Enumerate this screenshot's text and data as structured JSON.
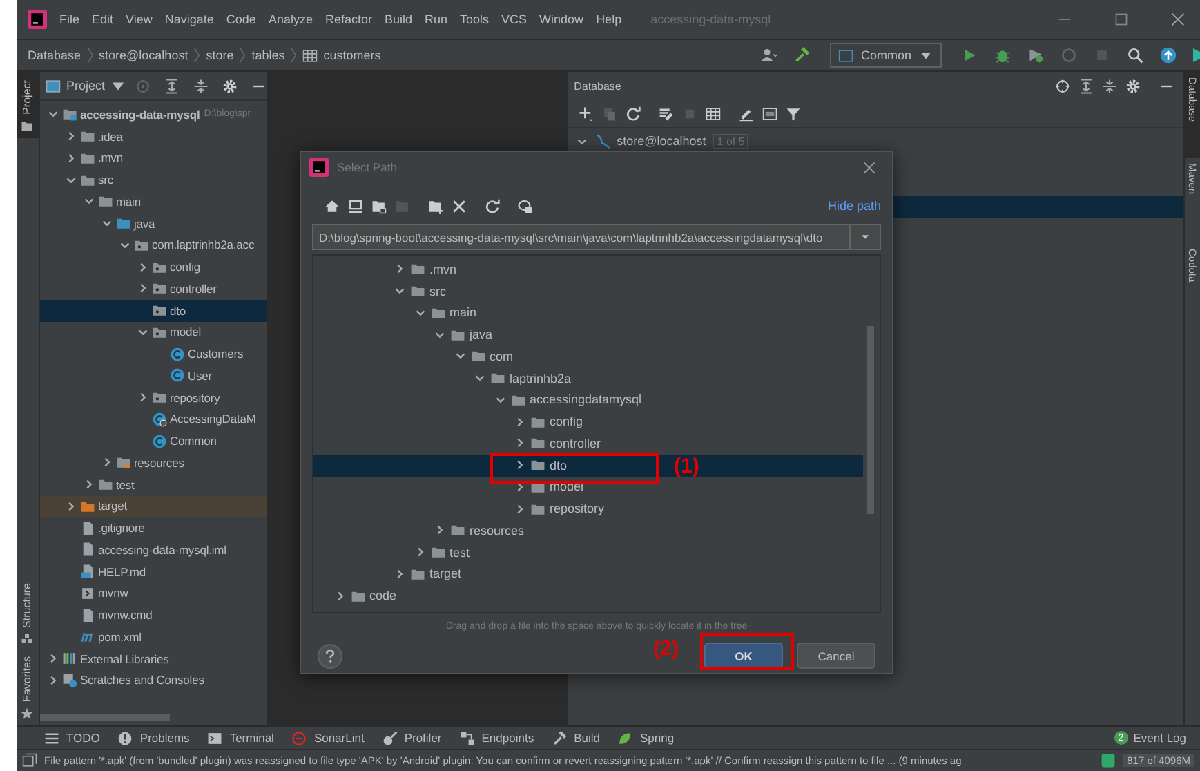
{
  "window": {
    "title": "accessing-data-mysql"
  },
  "menu": [
    "File",
    "Edit",
    "View",
    "Navigate",
    "Code",
    "Analyze",
    "Refactor",
    "Build",
    "Run",
    "Tools",
    "VCS",
    "Window",
    "Help"
  ],
  "breadcrumbs": [
    {
      "label": "Database",
      "kind": "text"
    },
    {
      "label": "store@localhost",
      "kind": "text"
    },
    {
      "label": "store",
      "kind": "text"
    },
    {
      "label": "tables",
      "kind": "text"
    },
    {
      "label": "customers",
      "kind": "table"
    }
  ],
  "run_config": {
    "label": "Common"
  },
  "left_stripe": [
    {
      "label": "Project",
      "selected": true
    },
    {
      "label": "Structure",
      "selected": false
    },
    {
      "label": "Favorites",
      "selected": false
    }
  ],
  "right_stripe": [
    {
      "label": "Database",
      "selected": true
    },
    {
      "label": "Maven",
      "selected": false
    },
    {
      "label": "Codota",
      "selected": false
    }
  ],
  "project": {
    "title": "Project",
    "tree": [
      {
        "label": "accessing-data-mysql",
        "hint": "D:\\blog\\spr",
        "kind": "module",
        "expanded": true,
        "selected": false,
        "children": [
          {
            "label": ".idea",
            "kind": "folder",
            "expanded": false,
            "selected": false
          },
          {
            "label": ".mvn",
            "kind": "folder",
            "expanded": false,
            "selected": false
          },
          {
            "label": "src",
            "kind": "folder",
            "expanded": true,
            "selected": false,
            "children": [
              {
                "label": "main",
                "kind": "folder",
                "expanded": true,
                "selected": false,
                "children": [
                  {
                    "label": "java",
                    "kind": "source",
                    "expanded": true,
                    "selected": false,
                    "children": [
                      {
                        "label": "com.laptrinhb2a.acc",
                        "kind": "package",
                        "expanded": true,
                        "selected": false,
                        "children": [
                          {
                            "label": "config",
                            "kind": "package",
                            "expanded": false,
                            "selected": false
                          },
                          {
                            "label": "controller",
                            "kind": "package",
                            "expanded": false,
                            "selected": false
                          },
                          {
                            "label": "dto",
                            "kind": "package",
                            "selected": true
                          },
                          {
                            "label": "model",
                            "kind": "package",
                            "expanded": true,
                            "selected": false,
                            "children": [
                              {
                                "label": "Customers",
                                "kind": "class",
                                "selected": false
                              },
                              {
                                "label": "User",
                                "kind": "class",
                                "selected": false
                              }
                            ]
                          },
                          {
                            "label": "repository",
                            "kind": "package",
                            "expanded": false,
                            "selected": false
                          },
                          {
                            "label": "AccessingDataM",
                            "kind": "appclass",
                            "selected": false
                          },
                          {
                            "label": "Common",
                            "kind": "class",
                            "selected": false
                          }
                        ]
                      }
                    ]
                  },
                  {
                    "label": "resources",
                    "kind": "resources",
                    "expanded": false,
                    "selected": false
                  }
                ]
              },
              {
                "label": "test",
                "kind": "folder",
                "expanded": false,
                "selected": false
              }
            ]
          },
          {
            "label": "target",
            "kind": "excluded",
            "expanded": false,
            "selected": false
          },
          {
            "label": ".gitignore",
            "kind": "file",
            "selected": false
          },
          {
            "label": "accessing-data-mysql.iml",
            "kind": "file",
            "selected": false
          },
          {
            "label": "HELP.md",
            "kind": "markdown",
            "selected": false
          },
          {
            "label": "mvnw",
            "kind": "script",
            "selected": false
          },
          {
            "label": "mvnw.cmd",
            "kind": "file",
            "selected": false
          },
          {
            "label": "pom.xml",
            "kind": "maven",
            "selected": false
          }
        ]
      },
      {
        "label": "External Libraries",
        "kind": "libraries",
        "expanded": false,
        "selected": false
      },
      {
        "label": "Scratches and Consoles",
        "kind": "scratches",
        "expanded": false,
        "selected": false
      }
    ]
  },
  "database": {
    "title": "Database",
    "tree": [
      {
        "label": "store@localhost",
        "badge": "1 of 5",
        "expanded": true
      }
    ]
  },
  "dialog": {
    "title": "Select Path",
    "hide_path": "Hide path",
    "path": "D:\\blog\\spring-boot\\accessing-data-mysql\\src\\main\\java\\com\\laptrinhb2a\\accessingdatamysql\\dto",
    "tree": [
      {
        "label": ".mvn",
        "expanded": false,
        "selected": false
      },
      {
        "label": "src",
        "expanded": true,
        "selected": false,
        "children": [
          {
            "label": "main",
            "expanded": true,
            "selected": false,
            "children": [
              {
                "label": "java",
                "expanded": true,
                "selected": false,
                "children": [
                  {
                    "label": "com",
                    "expanded": true,
                    "selected": false,
                    "children": [
                      {
                        "label": "laptrinhb2a",
                        "expanded": true,
                        "selected": false,
                        "children": [
                          {
                            "label": "accessingdatamysql",
                            "expanded": true,
                            "selected": false,
                            "children": [
                              {
                                "label": "config",
                                "expanded": false,
                                "selected": false
                              },
                              {
                                "label": "controller",
                                "expanded": false,
                                "selected": false
                              },
                              {
                                "label": "dto",
                                "expanded": false,
                                "selected": true
                              },
                              {
                                "label": "model",
                                "expanded": false,
                                "selected": false
                              },
                              {
                                "label": "repository",
                                "expanded": false,
                                "selected": false
                              }
                            ]
                          }
                        ]
                      }
                    ]
                  }
                ]
              },
              {
                "label": "resources",
                "expanded": false,
                "selected": false
              }
            ]
          },
          {
            "label": "test",
            "expanded": false,
            "selected": false
          }
        ]
      },
      {
        "label": "target",
        "expanded": false,
        "selected": false
      }
    ],
    "outer_tree": [
      {
        "label": "code",
        "expanded": false,
        "selected": false
      }
    ],
    "hint": "Drag and drop a file into the space above to quickly locate it in the tree",
    "buttons": [
      {
        "label": "OK",
        "default": true
      },
      {
        "label": "Cancel",
        "default": false
      }
    ],
    "annotations": [
      {
        "label": "(1)"
      },
      {
        "label": "(2)"
      }
    ]
  },
  "tool_windows": [
    "TODO",
    "Problems",
    "Terminal",
    "SonarLint",
    "Profiler",
    "Endpoints",
    "Build",
    "Spring"
  ],
  "event_log": {
    "label": "Event Log",
    "badge": "2"
  },
  "status_bar": {
    "message": "File pattern '*.apk' (from 'bundled' plugin) was reassigned to file type 'APK' by 'Android' plugin: You can confirm or revert reassigning pattern '*.apk' // Confirm reassign this pattern to file ... (9 minutes ag",
    "memory": "817 of 4096M"
  }
}
